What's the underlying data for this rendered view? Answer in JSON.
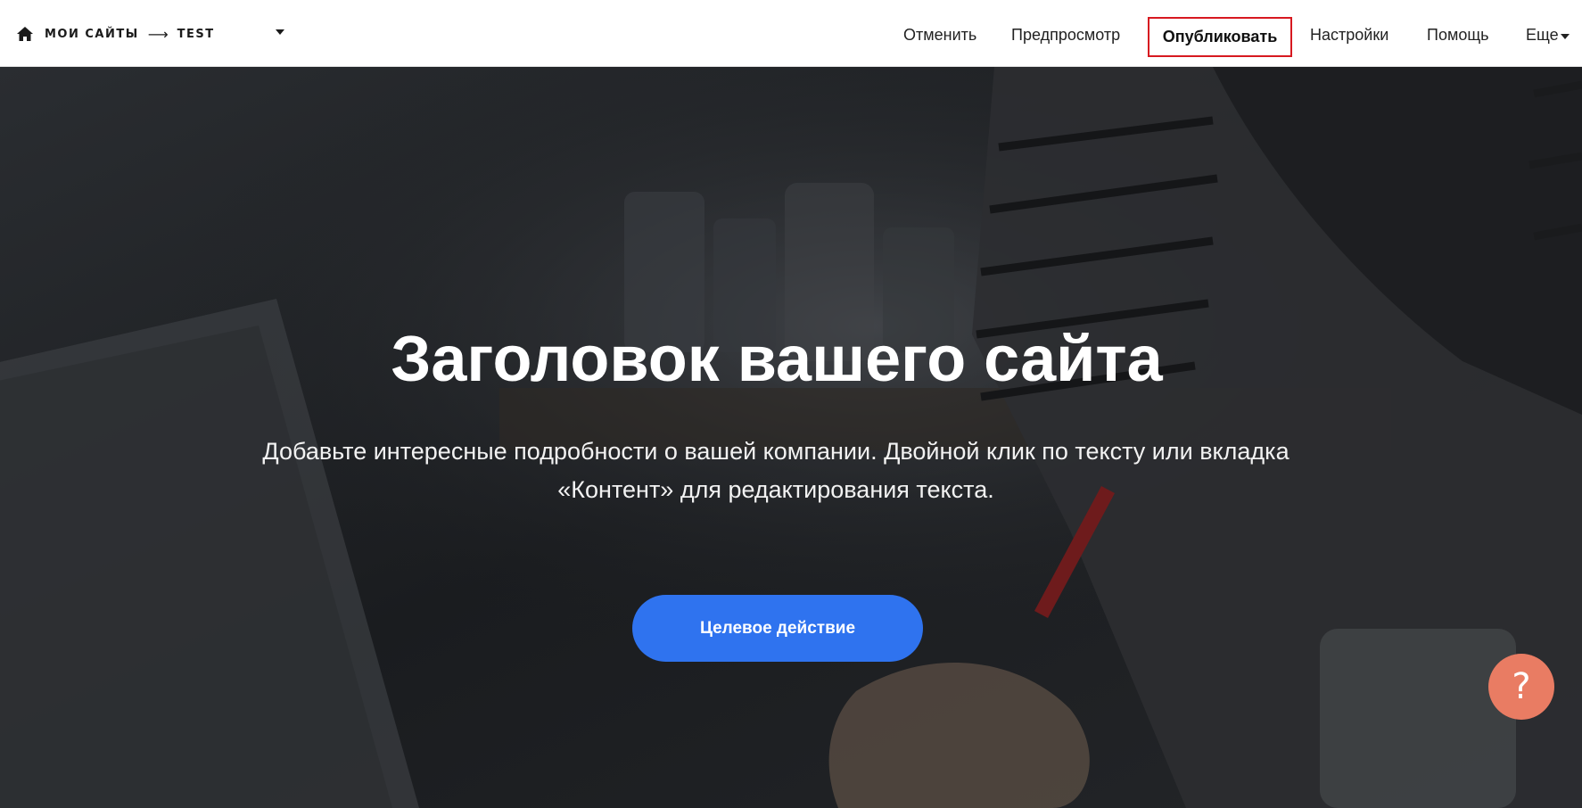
{
  "topbar": {
    "breadcrumb": {
      "home_icon": "home-icon",
      "my_sites": "МОИ САЙТЫ",
      "separator": "⟶",
      "current_site": "TEST"
    },
    "nav": {
      "undo": "Отменить",
      "preview": "Предпросмотр",
      "publish": "Опубликовать",
      "settings": "Настройки",
      "help": "Помощь",
      "more": "Еще"
    }
  },
  "hero": {
    "title": "Заголовок вашего сайта",
    "subtitle": "Добавьте интересные подробности о вашей компании. Двойной клик по тексту или вкладка «Контент» для редактирования текста.",
    "cta_label": "Целевое действие"
  },
  "help_widget": {
    "glyph": "?",
    "color": "#e97c63"
  },
  "colors": {
    "accent": "#2f73ef",
    "publish_border": "#d71920"
  }
}
